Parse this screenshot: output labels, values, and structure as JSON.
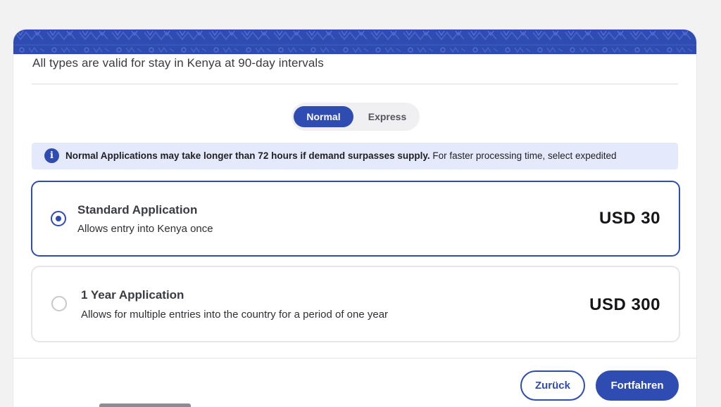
{
  "subtitle": "All types are valid for stay in Kenya at 90-day intervals",
  "toggle": {
    "normal": "Normal",
    "express": "Express",
    "selected": "Normal"
  },
  "notice": {
    "icon": "info-icon",
    "bold_text": "Normal Applications may take longer than 72 hours if demand surpasses supply.",
    "text": " For faster processing time, select expedited"
  },
  "options": [
    {
      "title": "Standard Application",
      "description": "Allows entry into Kenya once",
      "price": "USD 30",
      "selected": true
    },
    {
      "title": "1 Year Application",
      "description": "Allows for multiple entries into the country for a period of one year",
      "price": "USD 300",
      "selected": false
    }
  ],
  "buttons": {
    "back": "Zurück",
    "next": "Fortfahren"
  },
  "colors": {
    "accent": "#2f4cb3",
    "notice_bg": "#e4eafb"
  }
}
